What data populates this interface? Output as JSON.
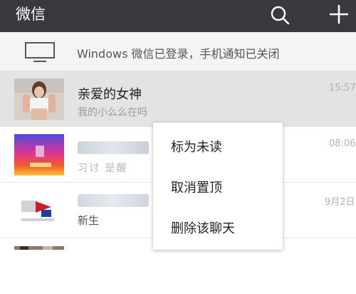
{
  "header": {
    "title": "微信",
    "icons": [
      "search-icon",
      "add-icon"
    ],
    "background": "#393a3f"
  },
  "banner": {
    "icon": "monitor-icon",
    "text": "Windows 微信已登录，手机通知已关闭"
  },
  "chats": [
    {
      "name": "亲爱的女神",
      "message": "我的小么么在吗",
      "time": "15:57",
      "pinned": true
    },
    {
      "name": "",
      "message": "习讨 是醒",
      "time": "08:06",
      "pinned": false
    },
    {
      "name": "",
      "message": "新生",
      "time": "9月2日",
      "pinned": false
    }
  ],
  "context_menu": {
    "items": [
      "标为未读",
      "取消置顶",
      "删除该聊天"
    ]
  }
}
